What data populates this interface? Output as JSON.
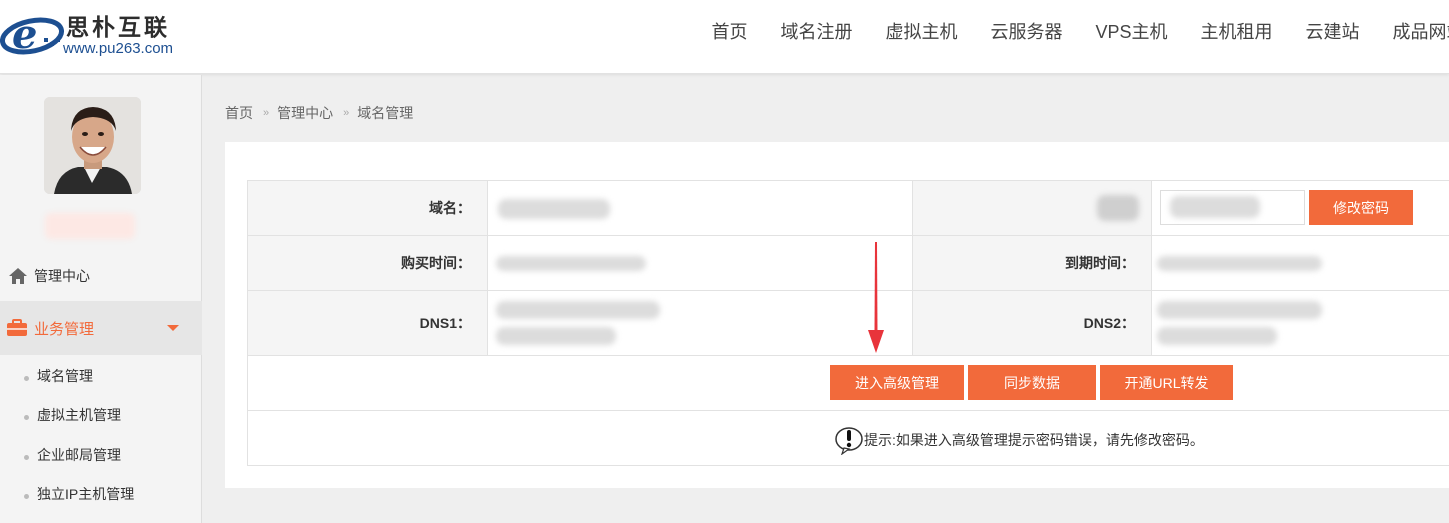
{
  "logo": {
    "cn": "思朴互联",
    "url": "www.pu263.com",
    "brand_color": "#1d4f91"
  },
  "nav": [
    "首页",
    "域名注册",
    "虚拟主机",
    "云服务器",
    "VPS主机",
    "主机租用",
    "云建站",
    "成品网站"
  ],
  "sidebar": {
    "home_label": "管理中心",
    "home_icon": "home-icon",
    "biz_label": "业务管理",
    "biz_icon": "briefcase-icon",
    "sub_items": [
      "域名管理",
      "虚拟主机管理",
      "企业邮局管理",
      "独立IP主机管理"
    ]
  },
  "breadcrumb": [
    "首页",
    "管理中心",
    "域名管理"
  ],
  "table": {
    "domain_label": "域名：",
    "purchase_label": "购买时间：",
    "expire_label": "到期时间：",
    "dns1_label": "DNS1：",
    "dns2_label": "DNS2：",
    "password_value": "",
    "change_password_button": "修改密码"
  },
  "actions": [
    "进入高级管理",
    "同步数据",
    "开通URL转发"
  ],
  "tip": "提示:如果进入高级管理提示密码错误，请先修改密码。",
  "colors": {
    "accent": "#f26a3b",
    "border": "#e2e2e2",
    "label_bg": "#f5f5f5"
  }
}
